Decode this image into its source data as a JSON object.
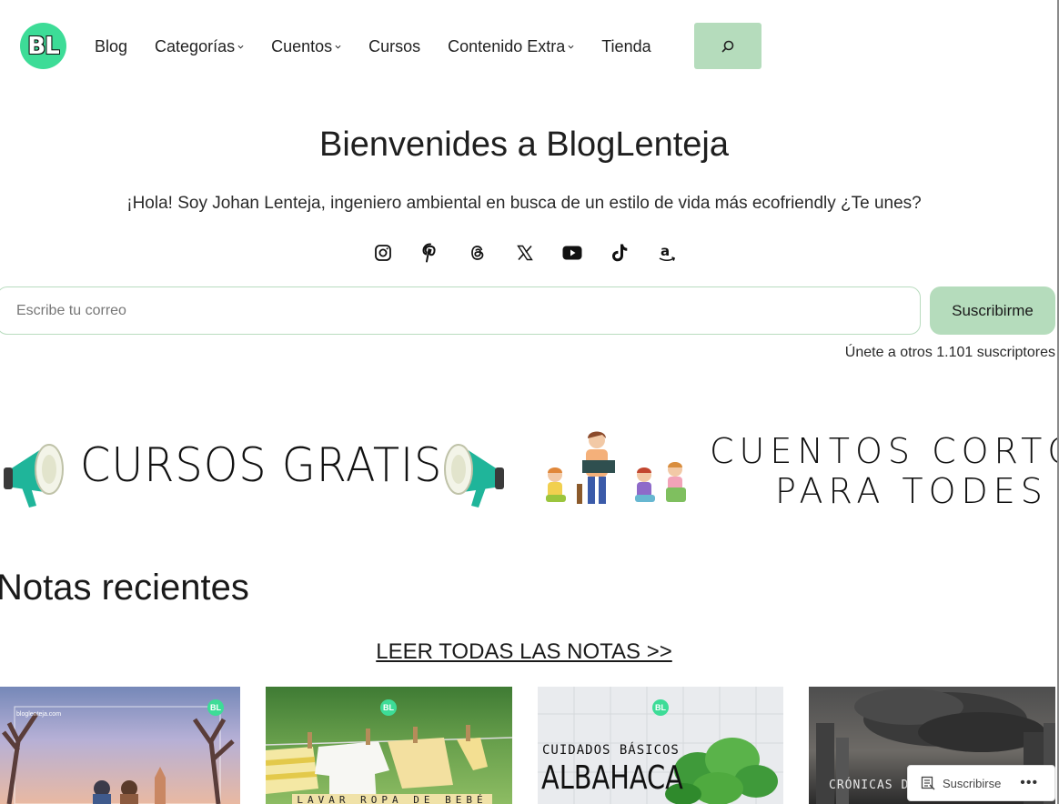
{
  "header": {
    "logo_text": "BL",
    "nav": [
      {
        "label": "Blog",
        "dropdown": false
      },
      {
        "label": "Categorías",
        "dropdown": true
      },
      {
        "label": "Cuentos",
        "dropdown": true
      },
      {
        "label": "Cursos",
        "dropdown": false
      },
      {
        "label": "Contenido Extra",
        "dropdown": true
      },
      {
        "label": "Tienda",
        "dropdown": false
      }
    ],
    "search_icon": "search-icon"
  },
  "hero": {
    "title": "Bienvenides a BlogLenteja",
    "subtitle": "¡Hola! Soy Johan Lenteja, ingeniero ambiental en busca de un estilo de vida más ecofriendly ¿Te unes?",
    "social_icons": [
      "instagram-icon",
      "pinterest-icon",
      "threads-icon",
      "x-icon",
      "youtube-icon",
      "tiktok-icon",
      "amazon-icon"
    ]
  },
  "subscribe": {
    "placeholder": "Escribe tu correo",
    "button_label": "Suscribirme",
    "count_text": "Únete a otros 1.101 suscriptores"
  },
  "banners": {
    "cursos": "CURSOS GRATIS",
    "cuentos_line1": "CUENTOS CORTOS",
    "cuentos_line2": "PARA TODES"
  },
  "notes": {
    "title": "Notas recientes",
    "read_all": "LEER TODAS LAS NOTAS >>",
    "cards": [
      {
        "badge": "BL",
        "tiny": "bloglenteja.com"
      },
      {
        "badge": "BL",
        "label": "LAVAR ROPA DE BEBÉ"
      },
      {
        "badge": "BL",
        "small": "CUIDADOS BÁSICOS",
        "big": "ALBAHACA"
      },
      {
        "text": "CRÓNICAS DE"
      }
    ]
  },
  "floating_bar": {
    "label": "Suscribirse",
    "more": "•••"
  },
  "colors": {
    "accent_green": "#b5dcbc",
    "logo_green": "#3ddc97"
  }
}
